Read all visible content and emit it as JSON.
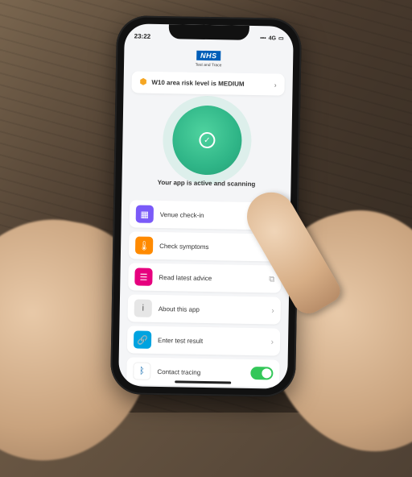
{
  "status_bar": {
    "time": "23:22",
    "signal_text": "4G"
  },
  "header": {
    "logo_text": "NHS",
    "subtitle": "Test and Trace"
  },
  "risk_banner": {
    "text": "W10 area risk level is MEDIUM"
  },
  "scan_status": {
    "text": "Your app is active and scanning"
  },
  "menu": {
    "items": [
      {
        "label": "Venue check-in",
        "icon_name": "qr-icon",
        "color": "#7a5af8",
        "action": "none"
      },
      {
        "label": "Check symptoms",
        "icon_name": "thermometer-icon",
        "color": "#ff8a00",
        "action": "none"
      },
      {
        "label": "Read latest advice",
        "icon_name": "news-icon",
        "color": "#e6007e",
        "action": "external"
      },
      {
        "label": "About this app",
        "icon_name": "info-icon",
        "color": "#e6e6e6",
        "action": "chevron"
      },
      {
        "label": "Enter test result",
        "icon_name": "link-icon",
        "color": "#00a3e0",
        "action": "chevron"
      },
      {
        "label": "Contact tracing",
        "icon_name": "bluetooth-icon",
        "color": "#ffffff",
        "action": "toggle"
      }
    ]
  }
}
